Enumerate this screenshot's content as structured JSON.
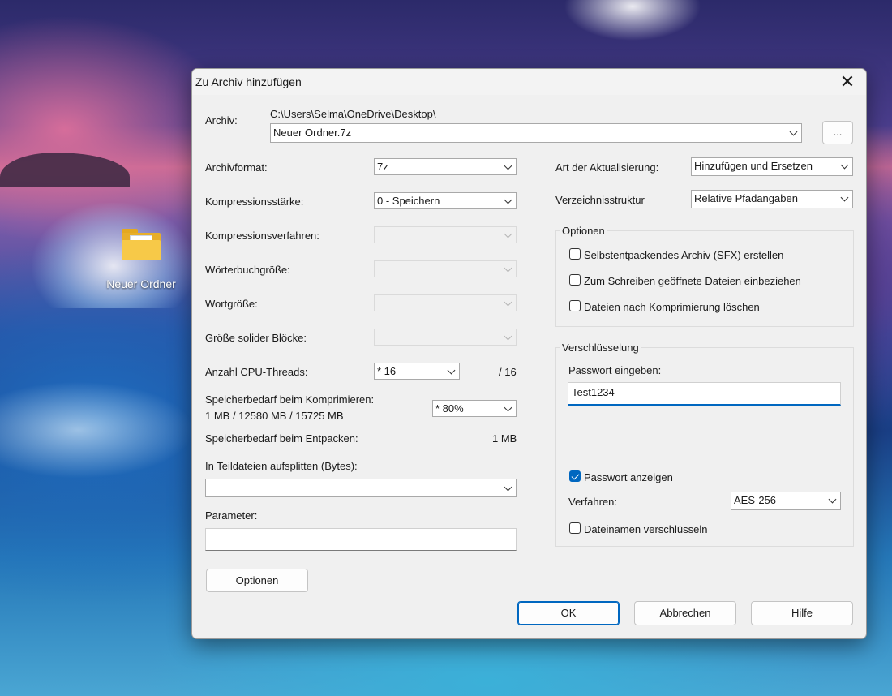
{
  "desktop": {
    "icon_label": "Neuer Ordner"
  },
  "dialog": {
    "title": "Zu Archiv hinzufügen",
    "archive_label": "Archiv:",
    "archive_path": "C:\\Users\\Selma\\OneDrive\\Desktop\\",
    "archive_name": "Neuer Ordner.7z",
    "browse_label": "...",
    "left": {
      "format_label": "Archivformat:",
      "format_value": "7z",
      "level_label": "Kompressionsstärke:",
      "level_value": "0 - Speichern",
      "method_label": "Kompressionsverfahren:",
      "method_value": "",
      "dict_label": "Wörterbuchgröße:",
      "dict_value": "",
      "word_label": "Wortgröße:",
      "word_value": "",
      "solid_label": "Größe solider Blöcke:",
      "solid_value": "",
      "threads_label": "Anzahl CPU-Threads:",
      "threads_value": "* 16",
      "threads_max": "/ 16",
      "mem_comp_label": "Speicherbedarf beim Komprimieren:",
      "mem_comp_values": "1 MB / 12580 MB / 15725 MB",
      "mem_comp_percent": "* 80%",
      "mem_decomp_label": "Speicherbedarf beim Entpacken:",
      "mem_decomp_value": "1 MB",
      "split_label": "In Teildateien aufsplitten (Bytes):",
      "split_value": "",
      "params_label": "Parameter:",
      "params_value": "",
      "options_button": "Optionen"
    },
    "right": {
      "update_label": "Art der Aktualisierung:",
      "update_value": "Hinzufügen und Ersetzen",
      "paths_label": "Verzeichnisstruktur",
      "paths_value": "Relative Pfadangaben",
      "options_group": "Optionen",
      "sfx_label": "Selbstentpackendes Archiv (SFX) erstellen",
      "sfx_checked": false,
      "shared_label": "Zum Schreiben geöffnete Dateien einbeziehen",
      "shared_checked": false,
      "delete_label": "Dateien nach Komprimierung löschen",
      "delete_checked": false,
      "encryption_group": "Verschlüsselung",
      "password_label": "Passwort eingeben:",
      "password_value": "Test1234",
      "show_password_label": "Passwort anzeigen",
      "show_password_checked": true,
      "method_label": "Verfahren:",
      "method_value": "AES-256",
      "encrypt_names_label": "Dateinamen verschlüsseln",
      "encrypt_names_checked": false
    },
    "buttons": {
      "ok": "OK",
      "cancel": "Abbrechen",
      "help": "Hilfe"
    }
  },
  "colors": {
    "accent": "#0067c0",
    "dialog_bg": "#f0f0f0"
  }
}
